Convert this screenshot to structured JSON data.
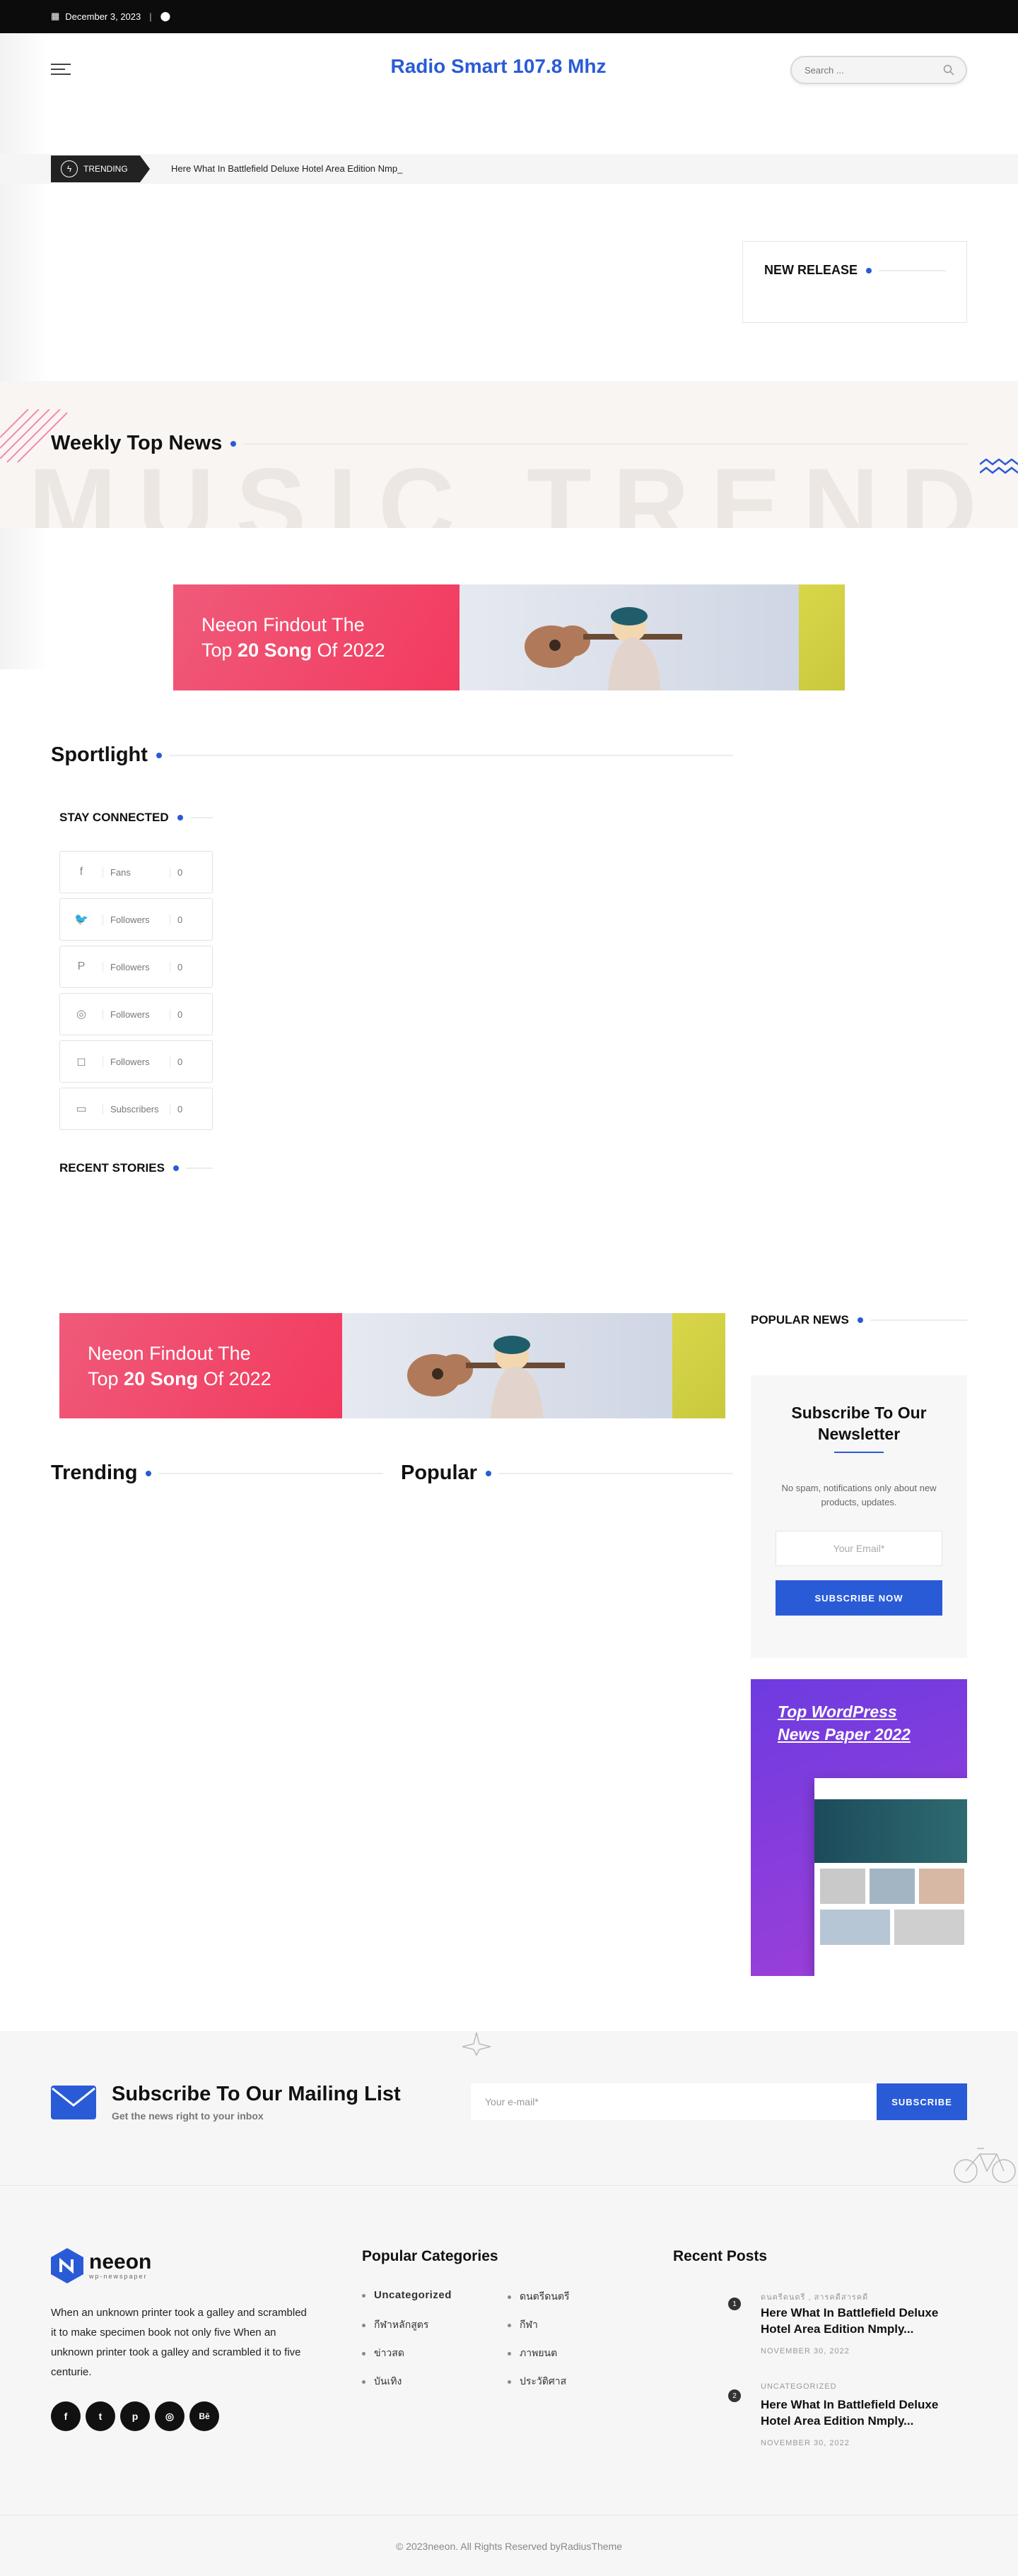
{
  "topbar": {
    "date": "December 3, 2023",
    "separator": "|"
  },
  "header": {
    "site_title": "Radio Smart 107.8 Mhz",
    "search_placeholder": "Search ..."
  },
  "trending": {
    "badge": "TRENDING",
    "headline": "Here What In Battlefield Deluxe Hotel Area Edition Nmp_"
  },
  "new_release": {
    "title": "NEW RELEASE"
  },
  "weekly": {
    "title": "Weekly Top News",
    "bg_text": "MUSIC TREND"
  },
  "banner": {
    "line1": "Neeon Findout The",
    "line2_pre": "Top ",
    "line2_bold": "20 Song",
    "line2_post": " Of 2022"
  },
  "sportlight": {
    "title": "Sportlight"
  },
  "stay_connected": {
    "title": "STAY CONNECTED",
    "items": [
      {
        "icon": "facebook-icon",
        "glyph": "f",
        "label": "Fans",
        "count": "0"
      },
      {
        "icon": "twitter-icon",
        "glyph": "🐦",
        "label": "Followers",
        "count": "0"
      },
      {
        "icon": "pinterest-icon",
        "glyph": "P",
        "label": "Followers",
        "count": "0"
      },
      {
        "icon": "dribbble-icon",
        "glyph": "◎",
        "label": "Followers",
        "count": "0"
      },
      {
        "icon": "instagram-icon",
        "glyph": "◻",
        "label": "Followers",
        "count": "0"
      },
      {
        "icon": "youtube-icon",
        "glyph": "▭",
        "label": "Subscribers",
        "count": "0"
      }
    ]
  },
  "recent_stories": {
    "title": "RECENT STORIES"
  },
  "popular_news": {
    "title": "POPULAR NEWS"
  },
  "trending_sect": {
    "title": "Trending"
  },
  "popular_sect": {
    "title": "Popular"
  },
  "newsletter": {
    "title_l1": "Subscribe To Our",
    "title_l2": "Newsletter",
    "desc": "No spam, notifications only about new products, updates.",
    "placeholder": "Your Email*",
    "button": "SUBSCRIBE NOW"
  },
  "wp_ad": {
    "line1": "Top WordPress",
    "line2": "News Paper 2022"
  },
  "mailing": {
    "title": "Subscribe To Our Mailing List",
    "subtitle": "Get the news right to your inbox",
    "placeholder": "Your e-mail*",
    "button": "SUBSCRIBE"
  },
  "footer": {
    "logo": "neeon",
    "logo_sub": "wp-newspaper",
    "about": "When an unknown printer took a galley and scrambled it to make specimen book not only five When an unknown printer took a galley and scrambled it to five centurie.",
    "social": [
      "f",
      "t",
      "p",
      "◎",
      "Bē"
    ],
    "cat_title": "Popular Categories",
    "categories_left": [
      "Uncategorized",
      "กีฬาหลักสูตร",
      "ข่าวสด",
      "บันเทิง"
    ],
    "categories_right": [
      "ดนตรีดนตรี",
      "กีฬา",
      "ภาพยนต",
      "ประวัติศาส"
    ],
    "recent_title": "Recent Posts",
    "posts": [
      {
        "num": "1",
        "category": "ดนตรีดนตรี , สารคดีสารคดี",
        "title": "Here What In Battlefield Deluxe Hotel Area Edition Nmply...",
        "date": "NOVEMBER 30, 2022"
      },
      {
        "num": "2",
        "category": "UNCATEGORIZED",
        "title": "Here What In Battlefield Deluxe Hotel Area Edition Nmply...",
        "date": "NOVEMBER 30, 2022"
      }
    ],
    "copyright": "© 2023neeon. All Rights Reserved byRadiusTheme"
  }
}
